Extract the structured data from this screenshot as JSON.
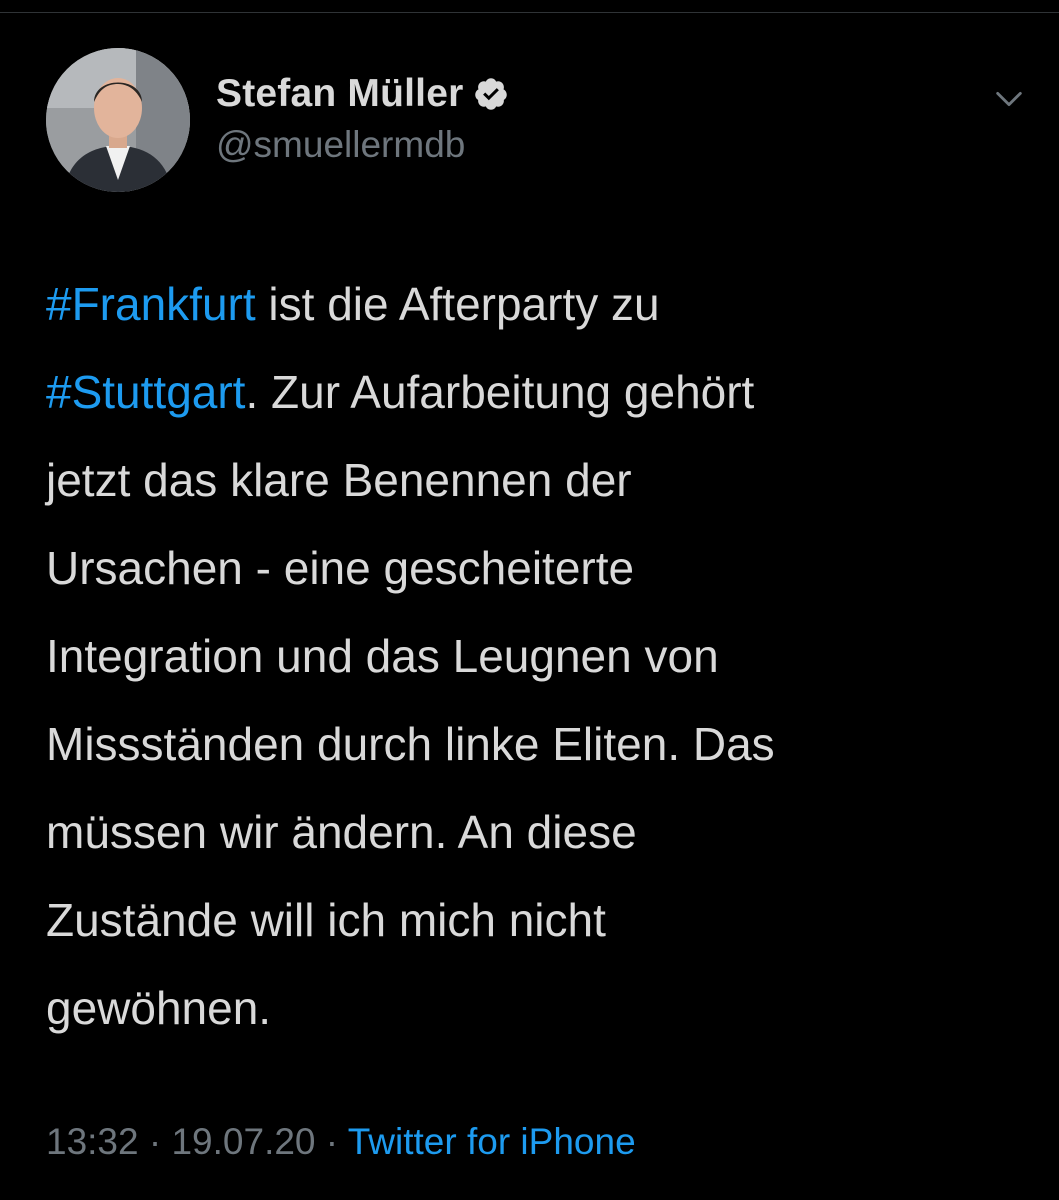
{
  "author": {
    "display_name": "Stefan Müller",
    "handle": "@smuellermdb",
    "verified": true
  },
  "icons": {
    "verified": "verified-badge-icon",
    "menu": "chevron-down-icon"
  },
  "tweet": {
    "lines": [
      {
        "hashtag": "#Frankfurt",
        "text": " ist die Afterparty zu"
      },
      {
        "hashtag": "#Stuttgart",
        "text": ". Zur Aufarbeitung gehört"
      },
      {
        "text": "jetzt das klare Benennen der"
      },
      {
        "text": "Ursachen - eine gescheiterte"
      },
      {
        "text": "Integration und das Leugnen von"
      },
      {
        "text": "Missständen durch linke Eliten. Das"
      },
      {
        "text": "müssen wir ändern. An diese"
      },
      {
        "text": "Zustände will ich mich nicht"
      },
      {
        "text": "gewöhnen."
      }
    ]
  },
  "meta": {
    "time": "13:32",
    "separator": " · ",
    "date": "19.07.20",
    "source": "Twitter for iPhone"
  },
  "colors": {
    "background": "#000000",
    "text": "#d9d9d9",
    "muted": "#6e767d",
    "accent": "#1d9bf0"
  }
}
